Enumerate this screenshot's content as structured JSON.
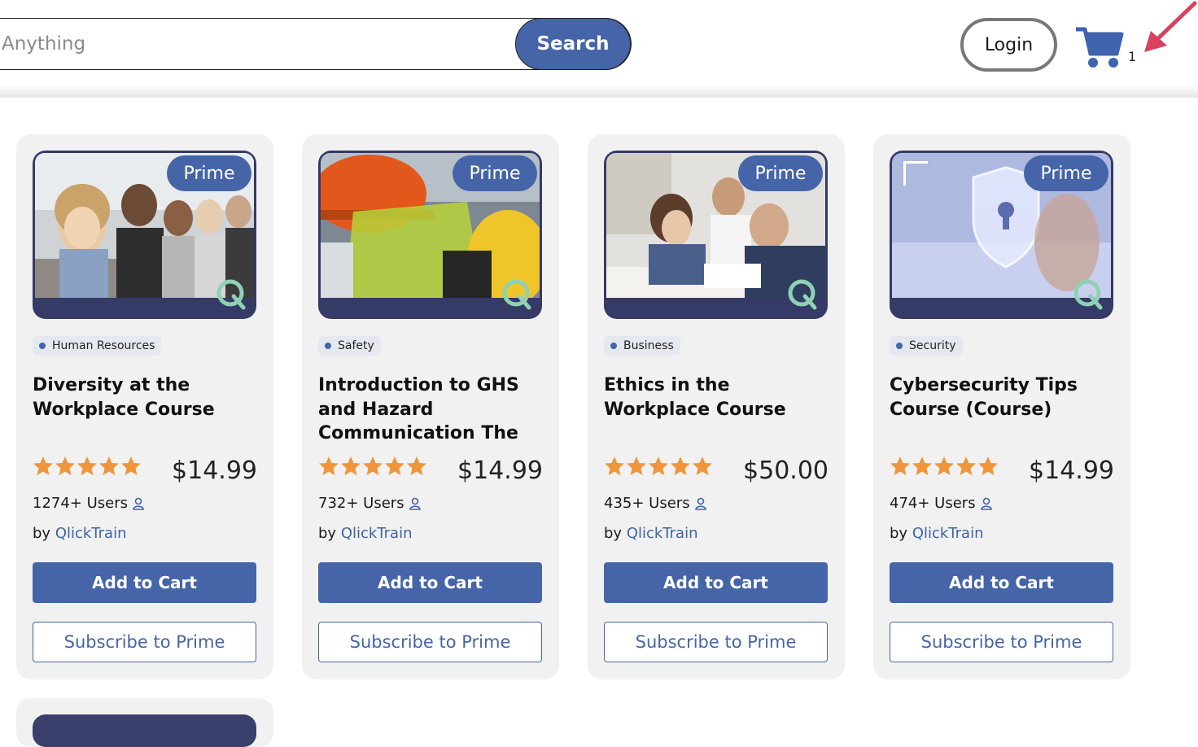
{
  "header": {
    "search_placeholder": "Anything",
    "search_button": "Search",
    "login_button": "Login",
    "cart_count": "1",
    "accent_color": "#4565a8"
  },
  "courses": [
    {
      "badge": "Prime",
      "category": "Human Resources",
      "title": "Diversity at the Workplace Course",
      "rating": 5,
      "price": "$14.99",
      "users": "1274+ Users",
      "by": "by",
      "author": "QlickTrain",
      "add_to_cart": "Add to Cart",
      "subscribe": "Subscribe to Prime",
      "image": "group-of-diverse-people-photo"
    },
    {
      "badge": "Prime",
      "category": "Safety",
      "title": "Introduction to GHS and Hazard Communication The",
      "rating": 5,
      "price": "$14.99",
      "users": "732+ Users",
      "by": "by",
      "author": "QlickTrain",
      "add_to_cart": "Add to Cart",
      "subscribe": "Subscribe to Prime",
      "image": "hard-hat-face-shield-photo"
    },
    {
      "badge": "Prime",
      "category": "Business",
      "title": "Ethics in the Workplace Course",
      "rating": 5,
      "price": "$50.00",
      "users": "435+ Users",
      "by": "by",
      "author": "QlickTrain",
      "add_to_cart": "Add to Cart",
      "subscribe": "Subscribe to Prime",
      "image": "office-colleagues-photo"
    },
    {
      "badge": "Prime",
      "category": "Security",
      "title": "Cybersecurity Tips Course (Course)",
      "rating": 5,
      "price": "$14.99",
      "users": "474+ Users",
      "by": "by",
      "author": "QlickTrain",
      "add_to_cart": "Add to Cart",
      "subscribe": "Subscribe to Prime",
      "image": "digital-shield-lock-photo"
    }
  ]
}
